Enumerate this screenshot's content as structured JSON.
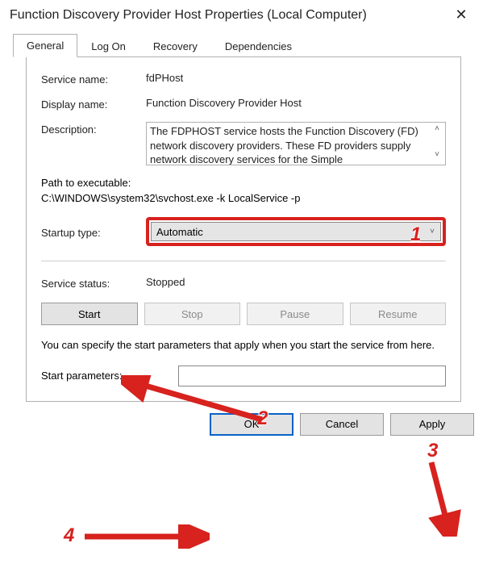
{
  "window": {
    "title": "Function Discovery Provider Host Properties (Local Computer)"
  },
  "tabs": {
    "t0": "General",
    "t1": "Log On",
    "t2": "Recovery",
    "t3": "Dependencies"
  },
  "labels": {
    "service_name": "Service name:",
    "display_name": "Display name:",
    "description": "Description:",
    "path_label": "Path to executable:",
    "startup_type": "Startup type:",
    "service_status": "Service status:",
    "hint": "You can specify the start parameters that apply when you start the service from here.",
    "start_parameters": "Start parameters:"
  },
  "values": {
    "service_name": "fdPHost",
    "display_name": "Function Discovery Provider Host",
    "description": "The FDPHOST service hosts the Function Discovery (FD) network discovery providers. These FD providers supply network discovery services for the Simple",
    "path": "C:\\WINDOWS\\system32\\svchost.exe -k LocalService -p",
    "startup_type": "Automatic",
    "service_status": "Stopped",
    "start_parameters": ""
  },
  "buttons": {
    "start": "Start",
    "stop": "Stop",
    "pause": "Pause",
    "resume": "Resume",
    "ok": "OK",
    "cancel": "Cancel",
    "apply": "Apply"
  },
  "annotations": {
    "n1": "1",
    "n2": "2",
    "n3": "3",
    "n4": "4"
  }
}
